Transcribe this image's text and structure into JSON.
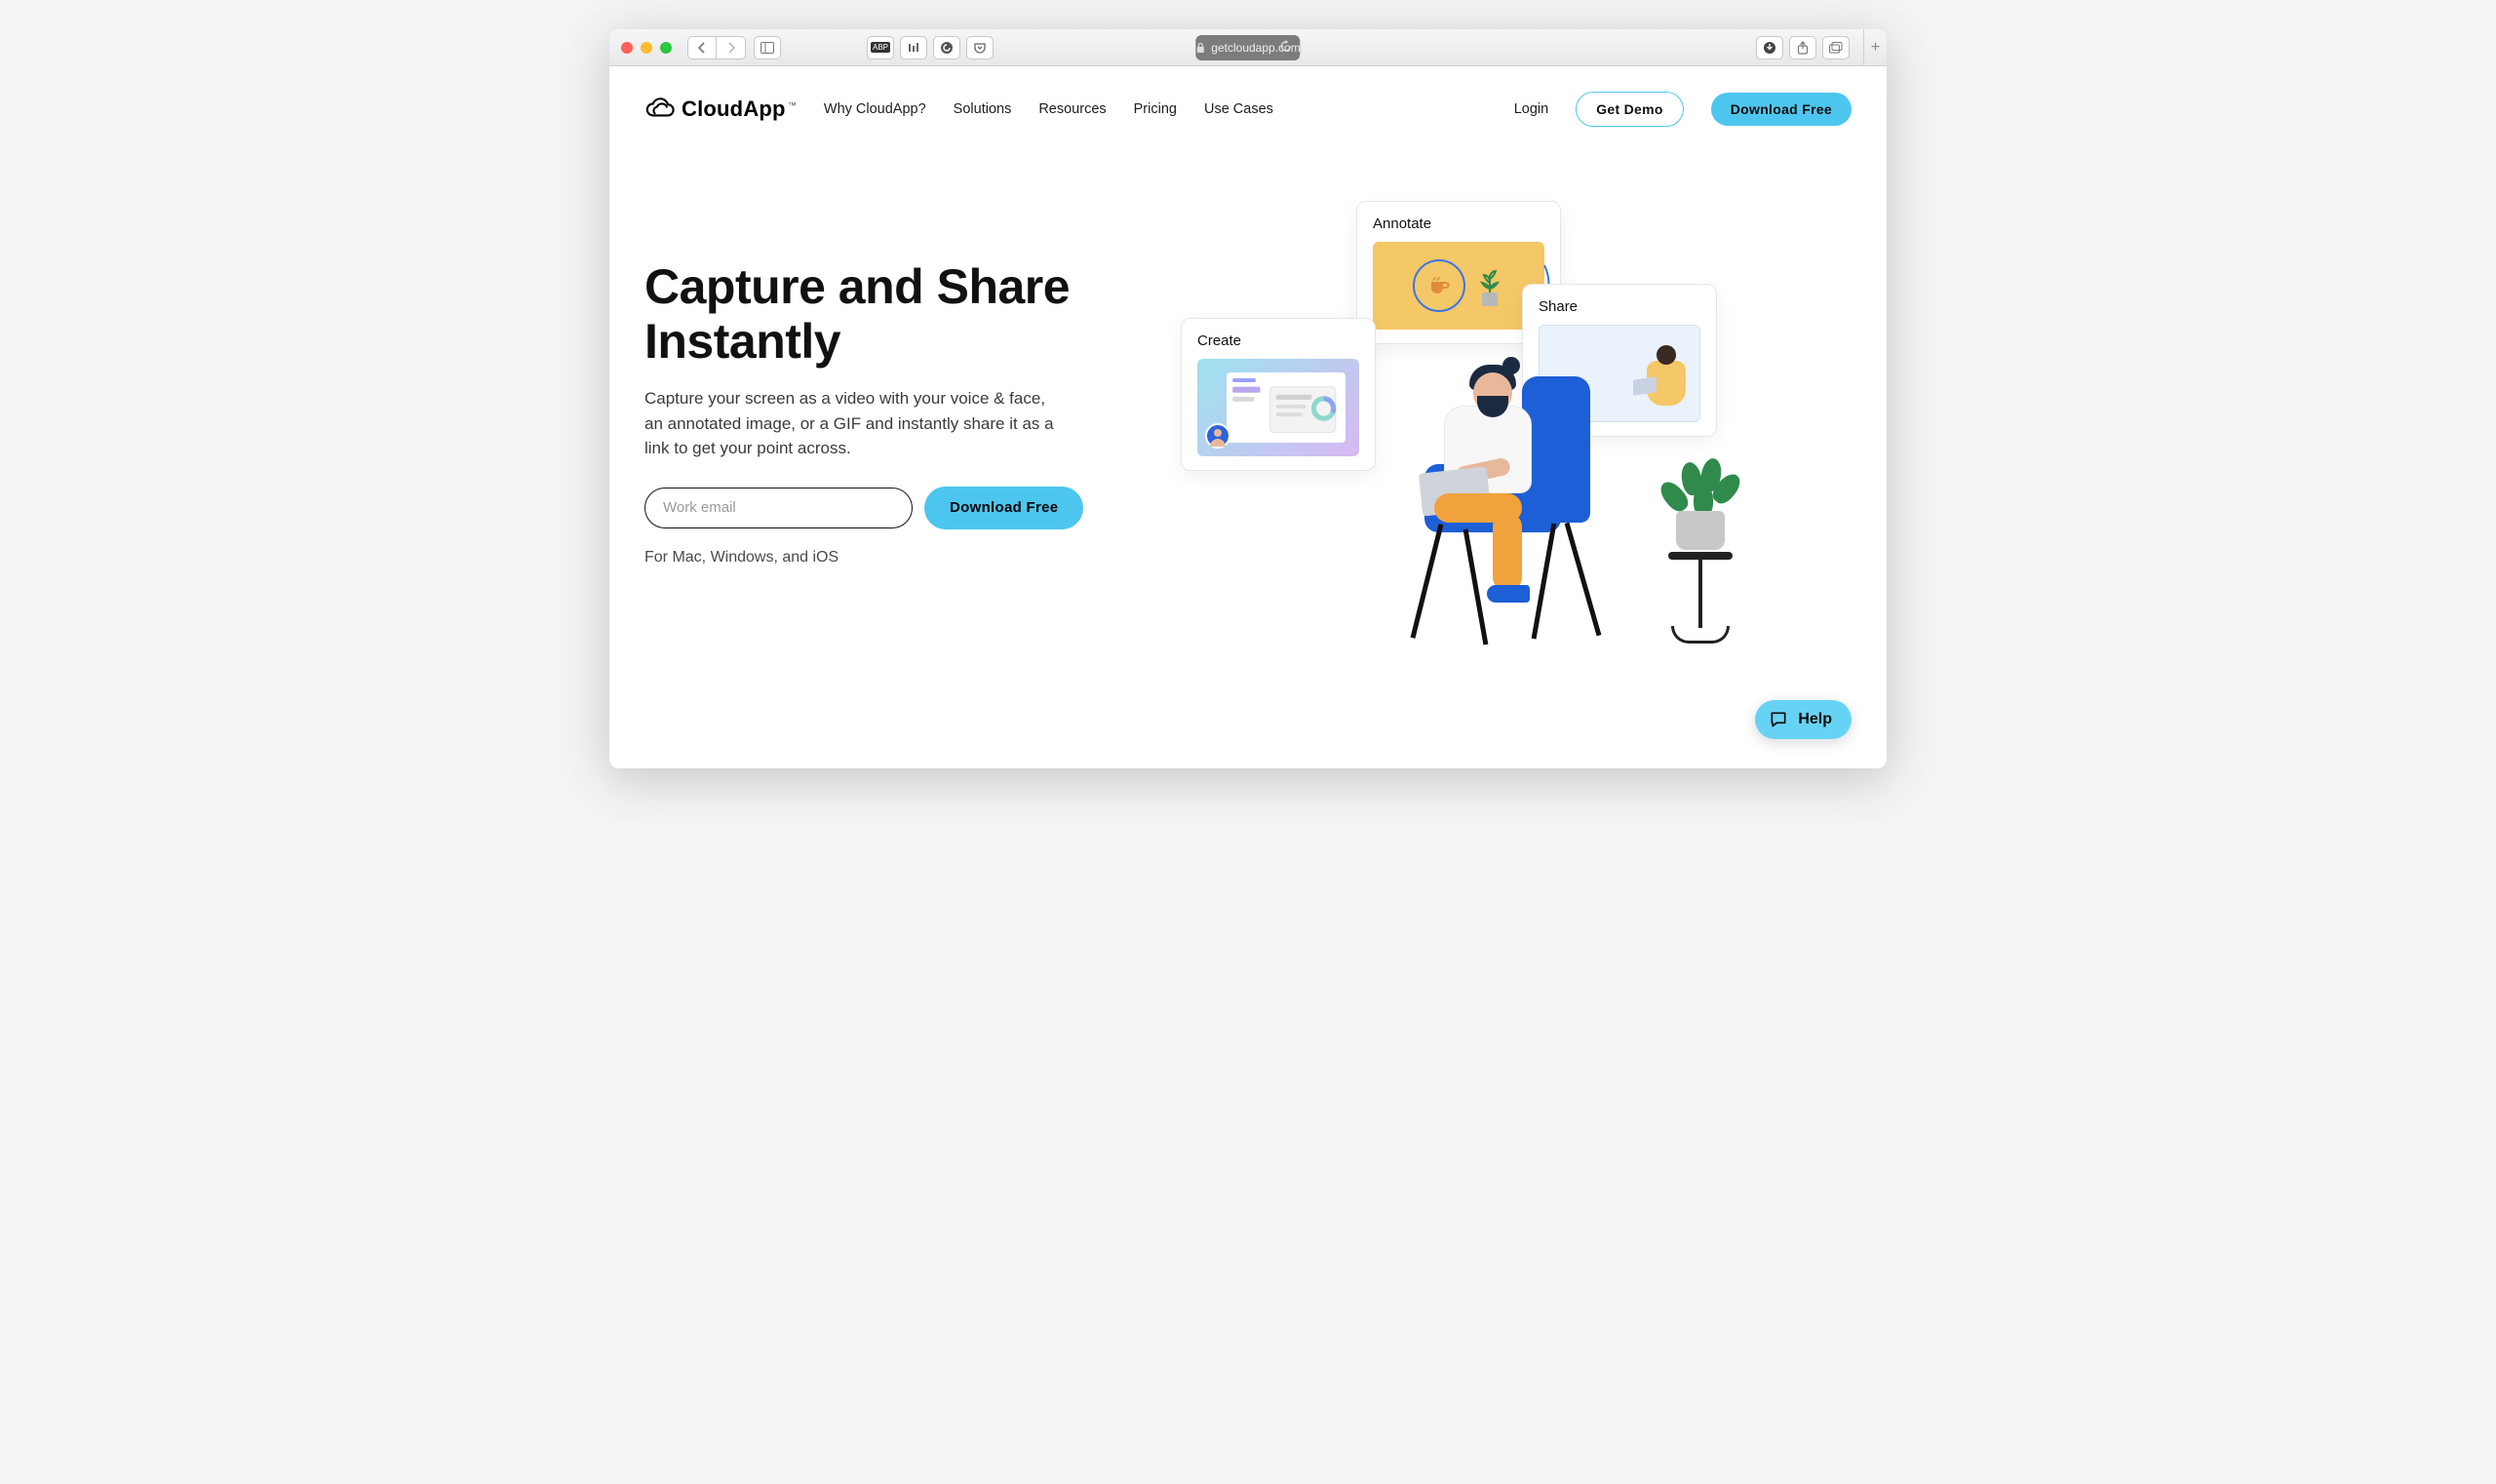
{
  "browser": {
    "url": "getcloudapp.com"
  },
  "nav": {
    "logo_text": "CloudApp",
    "logo_tm": "™",
    "items": [
      "Why CloudApp?",
      "Solutions",
      "Resources",
      "Pricing",
      "Use Cases"
    ],
    "login": "Login",
    "get_demo": "Get Demo",
    "download": "Download Free"
  },
  "hero": {
    "title": "Capture and Share Instantly",
    "subtitle": "Capture your screen as a video with your voice & face, an annotated image, or a GIF and instantly share it as a link to get your point across.",
    "email_placeholder": "Work email",
    "cta": "Download Free",
    "platforms": "For Mac, Windows, and iOS"
  },
  "cards": {
    "annotate": "Annotate",
    "create": "Create",
    "share": "Share"
  },
  "help": {
    "label": "Help"
  }
}
